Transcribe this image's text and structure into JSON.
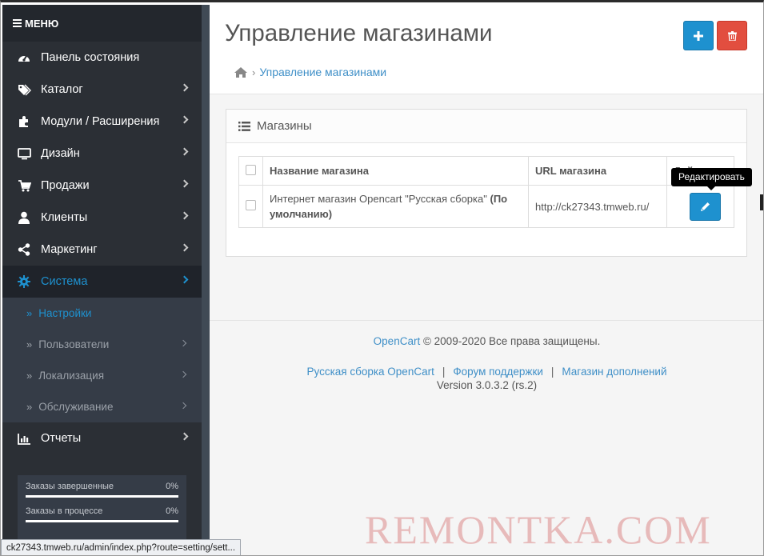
{
  "sidebar": {
    "menu_label": "МЕНЮ",
    "items": [
      {
        "label": "Панель состояния",
        "icon": "dashboard-icon",
        "has_arrow": false
      },
      {
        "label": "Каталог",
        "icon": "tags-icon",
        "has_arrow": true
      },
      {
        "label": "Модули / Расширения",
        "icon": "puzzle-icon",
        "has_arrow": true
      },
      {
        "label": "Дизайн",
        "icon": "monitor-icon",
        "has_arrow": true
      },
      {
        "label": "Продажи",
        "icon": "cart-icon",
        "has_arrow": true
      },
      {
        "label": "Клиенты",
        "icon": "user-icon",
        "has_arrow": true
      },
      {
        "label": "Маркетинг",
        "icon": "share-icon",
        "has_arrow": true
      },
      {
        "label": "Система",
        "icon": "gear-icon",
        "has_arrow": true,
        "active": true
      }
    ],
    "subitems": [
      {
        "label": "Настройки",
        "active": true,
        "has_arrow": false
      },
      {
        "label": "Пользователи",
        "has_arrow": true
      },
      {
        "label": "Локализация",
        "has_arrow": true
      },
      {
        "label": "Обслуживание",
        "has_arrow": true
      }
    ],
    "reports": {
      "label": "Отчеты",
      "icon": "bar-chart-icon"
    },
    "stats": [
      {
        "label": "Заказы завершенные",
        "value": "0%",
        "progress": 0
      },
      {
        "label": "Заказы в процессе",
        "value": "0%",
        "progress": 0
      }
    ]
  },
  "header": {
    "title": "Управление магазинами",
    "breadcrumb": "Управление магазинами"
  },
  "panel": {
    "title": "Магазины",
    "columns": [
      "Название магазина",
      "URL магазина",
      "Действие"
    ],
    "rows": [
      {
        "name": "Интернет магазин Opencart \"Русская сборка\"",
        "name_suffix": "(По умолчанию)",
        "url": "http://ck27343.tmweb.ru/"
      }
    ],
    "tooltip": "Редактировать"
  },
  "footer": {
    "brand": "OpenCart",
    "copyright": "© 2009-2020 Все права защищены.",
    "links": [
      "Русская сборка OpenCart",
      "Форум поддержки",
      "Магазин дополнений"
    ],
    "version": "Version 3.0.3.2 (rs.2)"
  },
  "status_bar": "ck27343.tmweb.ru/admin/index.php?route=setting/sett...",
  "watermark": "REMONTKA.COM",
  "colors": {
    "accent": "#1e91cf",
    "danger": "#e24e3f",
    "sidebar": "#2b2f35"
  }
}
